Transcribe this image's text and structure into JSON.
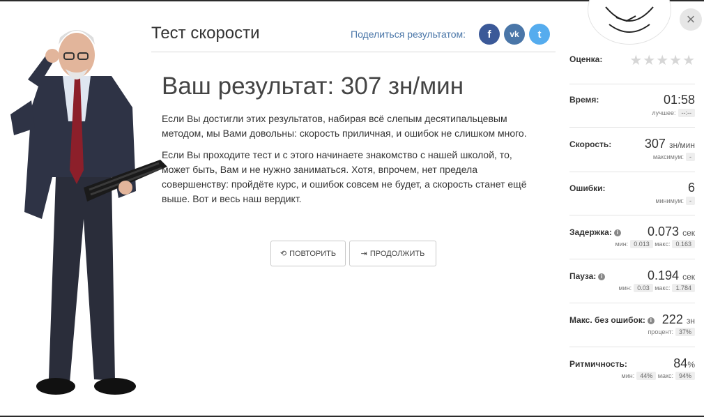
{
  "header": {
    "title": "Тест скорости",
    "share_label": "Поделиться результатом:",
    "social": [
      "f",
      "vk",
      "t"
    ]
  },
  "main": {
    "result_title": "Ваш результат: 307 зн/мин",
    "paragraph1": "Если Вы достигли этих результатов, набирая всё слепым десятипальцевым методом, мы Вами довольны: скорость приличная, и ошибок не слишком много.",
    "paragraph2": "Если Вы проходите тест и с этого начинаете знакомство с нашей школой, то, может быть, Вам и не нужно заниматься. Хотя, впрочем, нет предела совершенству: пройдёте курс, и ошибок совсем не будет, а скорость станет ещё выше. Вот и весь наш вердикт.",
    "buttons": {
      "repeat": "ПОВТОРИТЬ",
      "continue": "ПРОДОЛЖИТЬ"
    }
  },
  "stats": {
    "rating": {
      "label": "Оценка:",
      "stars_filled": 0,
      "stars_total": 5
    },
    "time": {
      "label": "Время:",
      "value": "01:58",
      "best_label": "лучшее:",
      "best_value": "--:--"
    },
    "speed": {
      "label": "Скорость:",
      "value": "307",
      "unit": "зн/мин",
      "max_label": "максимум:",
      "max_value": "-"
    },
    "errors": {
      "label": "Ошибки:",
      "value": "6",
      "min_label": "минимум:",
      "min_value": "-"
    },
    "delay": {
      "label": "Задержка:",
      "value": "0.073",
      "unit": "сек",
      "min_label": "мин:",
      "min_value": "0.013",
      "max_label": "макс:",
      "max_value": "0.163"
    },
    "pause": {
      "label": "Пауза:",
      "value": "0.194",
      "unit": "сек",
      "min_label": "мин:",
      "min_value": "0.03",
      "max_label": "макс:",
      "max_value": "1.784"
    },
    "max_no_errors": {
      "label": "Макс. без ошибок:",
      "value": "222",
      "unit": "зн",
      "percent_label": "процент:",
      "percent_value": "37%"
    },
    "rhythm": {
      "label": "Ритмичность:",
      "value": "84",
      "unit": "%",
      "min_label": "мин:",
      "min_value": "44%",
      "max_label": "макс:",
      "max_value": "94%"
    }
  },
  "close_symbol": "×",
  "info_symbol": "i"
}
